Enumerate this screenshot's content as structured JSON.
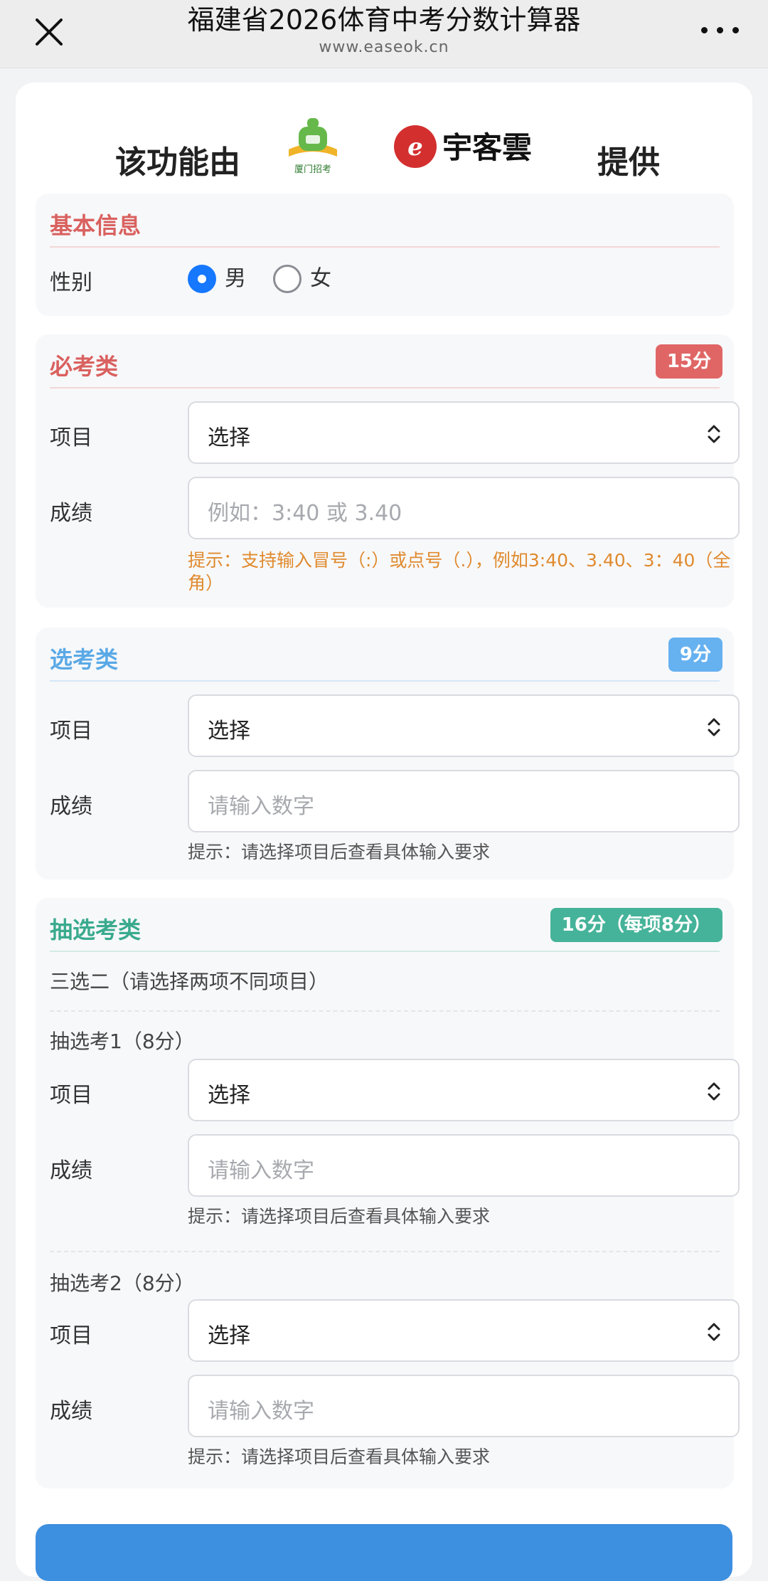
{
  "header": {
    "title": "福建省2026体育中考分数计算器",
    "url": "www.easeok.cn"
  },
  "provider": {
    "prefix": "该功能由",
    "logo1_text": "厦门招考",
    "logo2_text": "宇客雲",
    "suffix": "提供"
  },
  "basic": {
    "title": "基本信息",
    "gender_label": "性别",
    "options": [
      "男",
      "女"
    ],
    "selected": "男"
  },
  "required": {
    "title": "必考类",
    "badge": "15分",
    "project_label": "项目",
    "select_value": "选择",
    "score_label": "成绩",
    "score_placeholder": "例如：3:40 或 3.40",
    "hint": "提示：支持输入冒号（:）或点号（.），例如3:40、3.40、3：40（全角）"
  },
  "elective": {
    "title": "选考类",
    "badge": "9分",
    "project_label": "项目",
    "select_value": "选择",
    "score_label": "成绩",
    "score_placeholder": "请输入数字",
    "hint": "提示：请选择项目后查看具体输入要求"
  },
  "drawn": {
    "title": "抽选考类",
    "badge": "16分（每项8分）",
    "desc": "三选二（请选择两项不同项目）",
    "items": [
      {
        "title": "抽选考1（8分）",
        "project_label": "项目",
        "select_value": "选择",
        "score_label": "成绩",
        "score_placeholder": "请输入数字",
        "hint": "提示：请选择项目后查看具体输入要求"
      },
      {
        "title": "抽选考2（8分）",
        "project_label": "项目",
        "select_value": "选择",
        "score_label": "成绩",
        "score_placeholder": "请输入数字",
        "hint": "提示：请选择项目后查看具体输入要求"
      }
    ]
  },
  "colors": {
    "basic_title": "#d9615f",
    "required_title": "#d9615f",
    "required_badge": "#e06666",
    "elective_title": "#5aa9e6",
    "elective_badge": "#66b1f0",
    "drawn_title": "#3aaa8e",
    "drawn_badge": "#45b399",
    "hint_orange": "#e08a2e",
    "hint_gray": "#555555",
    "submit": "#3d8fdf"
  },
  "icons": {
    "close": "close-icon",
    "more": "more-icon",
    "select_arrows": "chevron-up-down-icon"
  }
}
